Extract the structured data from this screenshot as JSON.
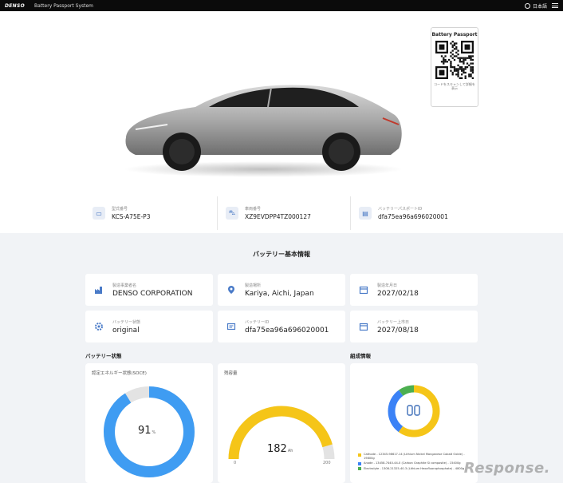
{
  "topbar": {
    "brand": "DENSO",
    "app_title": "Battery Passport System",
    "language": "日本語"
  },
  "passport_card": {
    "title": "Battery Passport",
    "caption": "コードをスキャンして詳細を表示"
  },
  "identifiers": [
    {
      "label": "型式番号",
      "value": "KCS-A75E-P3",
      "icon": "battery-icon"
    },
    {
      "label": "車両番号",
      "value": "XZ9EVDPP4TZ000127",
      "icon": "car-icon"
    },
    {
      "label": "バッテリーパスポートID",
      "value": "dfa75ea96a696020001",
      "icon": "id-card-icon"
    }
  ],
  "basic_info": {
    "title": "バッテリー基本情報",
    "cards": [
      {
        "label": "製造事業者名",
        "value": "DENSO CORPORATION",
        "icon": "factory-icon"
      },
      {
        "label": "製造場所",
        "value": "Kariya, Aichi, Japan",
        "icon": "location-icon"
      },
      {
        "label": "製造年月日",
        "value": "2027/02/18",
        "icon": "calendar-icon"
      },
      {
        "label": "バッテリー状態",
        "value": "original",
        "icon": "gear-icon"
      },
      {
        "label": "バッテリーID",
        "value": "dfa75ea96a696020001",
        "icon": "id-icon"
      },
      {
        "label": "バッテリー上市日",
        "value": "2027/08/18",
        "icon": "calendar-icon"
      }
    ]
  },
  "status": {
    "title": "バッテリー状態",
    "soce": {
      "label": "認定エネルギー状態(SOCE)",
      "value": "91",
      "unit": "%",
      "percent": 91
    },
    "capacity": {
      "label": "残容量",
      "value": "182",
      "unit": "Ah",
      "min": "0",
      "max": "200",
      "current": 182,
      "range_max": 200
    }
  },
  "composition": {
    "title": "組成情報",
    "legend": [
      {
        "text": "Cathode - 12345-98617-14 (Lithium Nickel Manganese Cobalt Oxide) - 19800g",
        "color": "#f5c518"
      },
      {
        "text": "Anode - 13458-7440-44-0 (Carbon Graphite Si composite) - 15400g",
        "color": "#3b82f6"
      },
      {
        "text": "Electrolyte - 1308-21325-40-3 (Lithium Hexafluorophosphate) - 4800g",
        "color": "#4caf50"
      }
    ],
    "shares": [
      0.6,
      0.3,
      0.1
    ]
  },
  "watermark": "Response.",
  "colors": {
    "accent_blue": "#3f9cf2",
    "accent_yellow": "#f5c518",
    "track": "#e3e3e3"
  }
}
